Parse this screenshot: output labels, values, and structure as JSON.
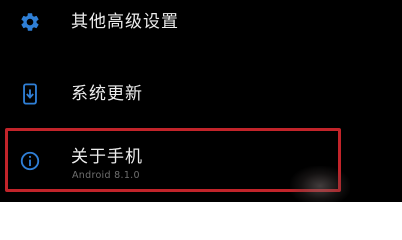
{
  "settings": {
    "items": [
      {
        "label": "其他高级设置",
        "icon": "gear-icon"
      },
      {
        "label": "系统更新",
        "icon": "system-update-icon"
      },
      {
        "label": "关于手机",
        "sublabel": "Android 8.1.0",
        "icon": "info-icon"
      }
    ]
  },
  "colors": {
    "background": "#000000",
    "accent_icon": "#2f7fd6",
    "highlight_border": "#c2242a",
    "primary_text": "#ececec",
    "secondary_text": "#6f6f6f"
  }
}
